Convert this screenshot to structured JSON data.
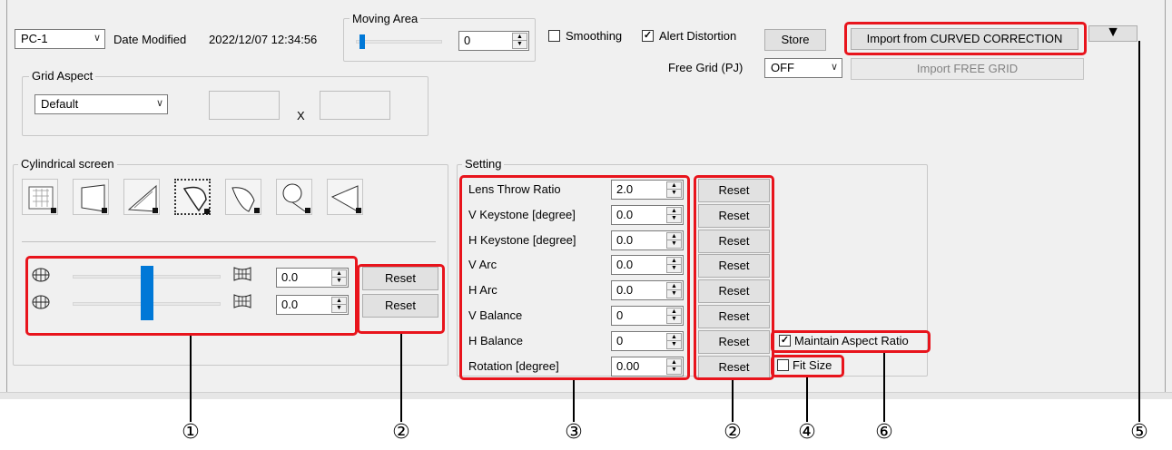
{
  "top": {
    "source_select": "PC-1",
    "date_modified_label": "Date Modified",
    "date_modified_value": "2022/12/07 12:34:56",
    "moving_area_label": "Moving Area",
    "moving_area_value": "0",
    "smoothing_label": "Smoothing",
    "smoothing_checked": false,
    "alert_distortion_label": "Alert Distortion",
    "alert_distortion_checked": true,
    "store_label": "Store",
    "import_curved_label": "Import from CURVED CORRECTION",
    "free_grid_label": "Free Grid (PJ)",
    "free_grid_value": "OFF",
    "import_free_grid_label": "Import FREE GRID",
    "menu_arrow_symbol": "▼"
  },
  "grid_aspect": {
    "title": "Grid Aspect",
    "select_value": "Default",
    "x_label": "X",
    "width_value": "",
    "height_value": ""
  },
  "cylindrical": {
    "title": "Cylindrical screen",
    "mode_icons": [
      "grid-mode-icon",
      "keystone-mode-icon",
      "perspective-mode-icon",
      "cylinder-arc-mode-icon",
      "cylinder-side-mode-icon",
      "dome-mode-icon",
      "corner-mode-icon"
    ],
    "selected_mode_index": 3,
    "sliders": [
      {
        "value": "0.0",
        "position": 0.5,
        "reset_label": "Reset",
        "left_icon": "horizontal-arc-globe-icon",
        "right_icon": "horizontal-warp-icon"
      },
      {
        "value": "0.0",
        "position": 0.5,
        "reset_label": "Reset",
        "left_icon": "vertical-arc-globe-icon",
        "right_icon": "vertical-warp-icon"
      }
    ]
  },
  "setting": {
    "title": "Setting",
    "rows": [
      {
        "label": "Lens Throw Ratio",
        "value": "2.0",
        "reset_label": "Reset"
      },
      {
        "label": "V Keystone [degree]",
        "value": "0.0",
        "reset_label": "Reset"
      },
      {
        "label": "H Keystone [degree]",
        "value": "0.0",
        "reset_label": "Reset"
      },
      {
        "label": "V Arc",
        "value": "0.0",
        "reset_label": "Reset"
      },
      {
        "label": "H Arc",
        "value": "0.0",
        "reset_label": "Reset"
      },
      {
        "label": "V Balance",
        "value": "0",
        "reset_label": "Reset"
      },
      {
        "label": "H Balance",
        "value": "0",
        "reset_label": "Reset"
      },
      {
        "label": "Rotation [degree]",
        "value": "0.00",
        "reset_label": "Reset"
      }
    ],
    "maintain_aspect_label": "Maintain Aspect Ratio",
    "maintain_aspect_checked": true,
    "fit_size_label": "Fit Size",
    "fit_size_checked": false
  },
  "callouts": [
    "①",
    "②",
    "③",
    "②",
    "④",
    "⑥",
    "⑤"
  ],
  "colors": {
    "highlight": "#e8141c",
    "slider_thumb": "#0078d7",
    "panel_bg": "#f0f0f0"
  }
}
